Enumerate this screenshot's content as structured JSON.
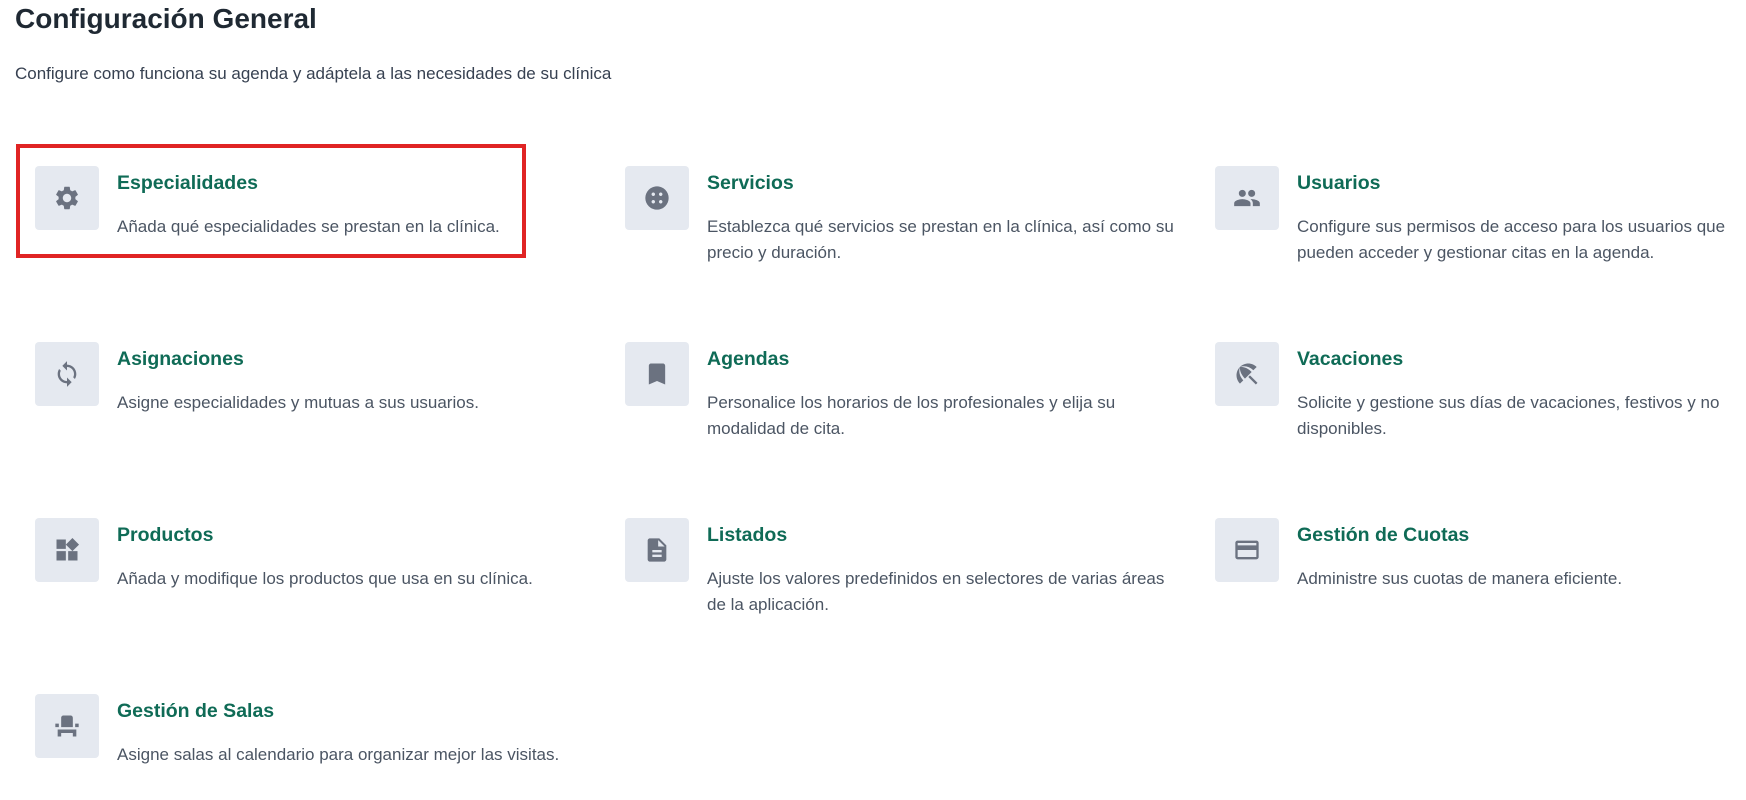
{
  "header": {
    "title": "Configuración General",
    "subtitle": "Configure como funciona su agenda y adáptela a las necesidades de su clínica"
  },
  "cards": [
    {
      "id": "especialidades",
      "icon": "gear-icon",
      "title": "Especialidades",
      "description": "Añada qué especialidades se prestan en la clínica."
    },
    {
      "id": "servicios",
      "icon": "services-icon",
      "title": "Servicios",
      "description": "Establezca qué servicios se prestan en la clínica, así como su precio y duración."
    },
    {
      "id": "usuarios",
      "icon": "users-icon",
      "title": "Usuarios",
      "description": "Configure sus permisos de acceso para los usuarios que pueden acceder y gestionar citas en la agenda."
    },
    {
      "id": "asignaciones",
      "icon": "sync-icon",
      "title": "Asignaciones",
      "description": "Asigne especialidades y mutuas a sus usuarios."
    },
    {
      "id": "agendas",
      "icon": "bookmark-icon",
      "title": "Agendas",
      "description": "Personalice los horarios de los profesionales y elija su modalidad de cita."
    },
    {
      "id": "vacaciones",
      "icon": "beach-umbrella-icon",
      "title": "Vacaciones",
      "description": "Solicite y gestione sus días de vacaciones, festivos y no disponibles."
    },
    {
      "id": "productos",
      "icon": "widgets-icon",
      "title": "Productos",
      "description": "Añada y modifique los productos que usa en su clínica."
    },
    {
      "id": "listados",
      "icon": "document-icon",
      "title": "Listados",
      "description": "Ajuste los valores predefinidos en selectores de varias áreas de la aplicación."
    },
    {
      "id": "cuotas",
      "icon": "credit-card-icon",
      "title": "Gestión de Cuotas",
      "description": "Administre sus cuotas de manera eficiente."
    },
    {
      "id": "salas",
      "icon": "chair-icon",
      "title": "Gestión de Salas",
      "description": "Asigne salas al calendario para organizar mejor las visitas."
    }
  ],
  "colors": {
    "title_accent": "#0f6b56",
    "icon_bg": "#e5e9f0",
    "icon_fg": "#6b7280",
    "highlight": "#e02424"
  }
}
